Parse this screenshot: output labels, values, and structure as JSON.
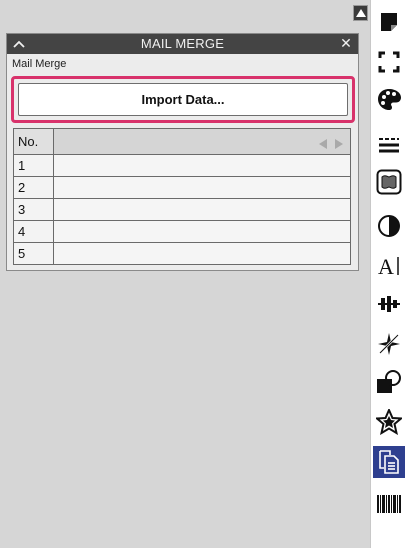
{
  "panel": {
    "title": "MAIL MERGE",
    "subtitle": "Mail Merge",
    "import_label": "Import Data...",
    "table": {
      "header_no": "No.",
      "header_data": "",
      "rows": [
        "1",
        "2",
        "3",
        "4",
        "5"
      ]
    }
  },
  "toolbar": {
    "tools": [
      "page-setup-icon",
      "selection-frame-icon",
      "palette-icon",
      "line-style-icon",
      "fill-pattern-icon",
      "contrast-icon",
      "text-icon",
      "align-icon",
      "effects-icon",
      "shape-icon",
      "star-icon",
      "mail-merge-icon",
      "barcode-icon"
    ],
    "active": "mail-merge-icon"
  },
  "colors": {
    "titlebar": "#444444",
    "highlight": "#d8326b",
    "active_tool": "#2e3f8f"
  }
}
